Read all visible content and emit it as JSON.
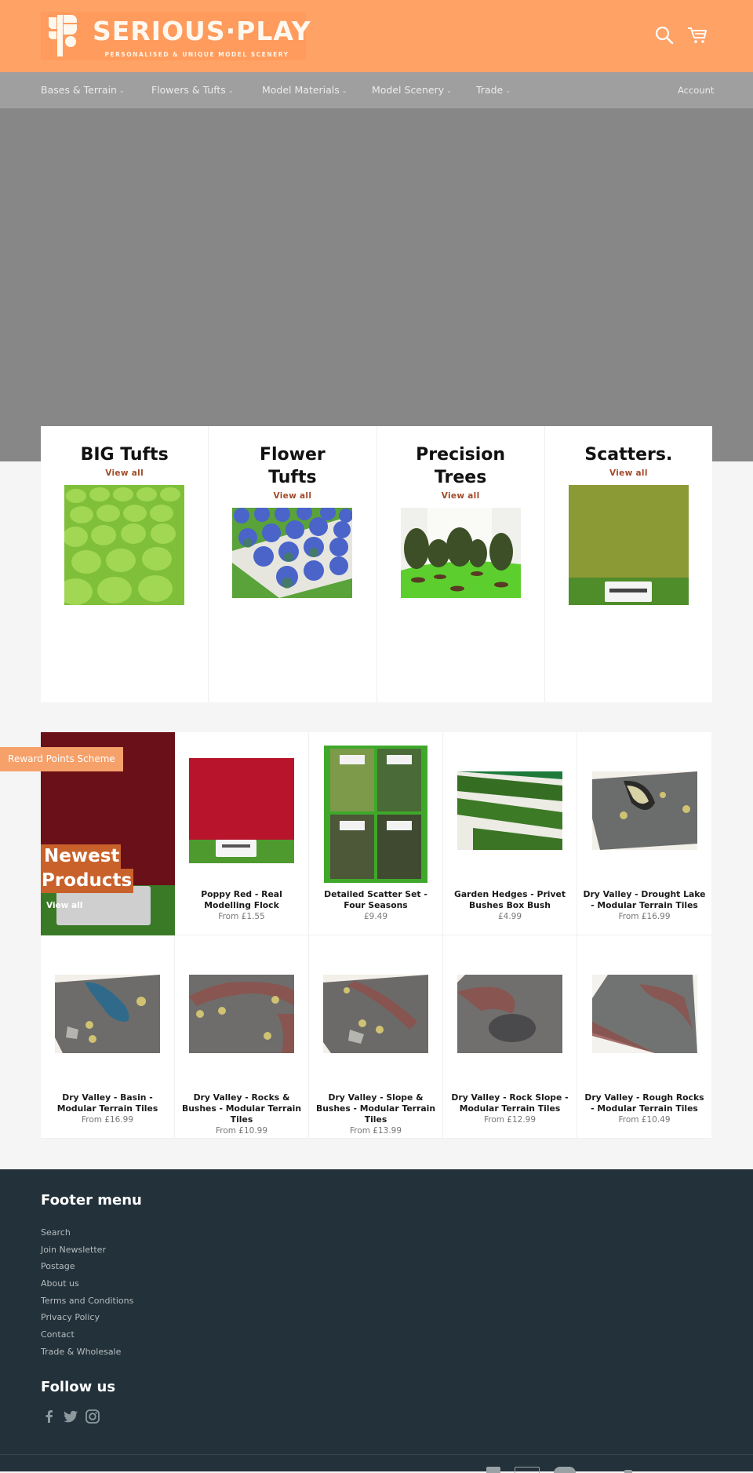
{
  "header": {
    "logo": {
      "wordmark": "SERIOUS·PLAY",
      "tagline": "PERSONALISED & UNIQUE MODEL SCENERY",
      "icon": "sp-monogram-icon"
    },
    "icons": [
      "search-icon",
      "cart-icon"
    ]
  },
  "nav": {
    "items": [
      {
        "label": "Bases & Terrain",
        "caret": "⌄"
      },
      {
        "label": "Flowers & Tufts",
        "caret": "⌄"
      },
      {
        "label": "Model Materials",
        "caret": "⌄"
      },
      {
        "label": "Model Scenery",
        "caret": "⌄"
      },
      {
        "label": "Trade",
        "caret": "⌄"
      }
    ],
    "account_label": "Account"
  },
  "collections": [
    {
      "title": "BIG Tufts",
      "link": "View all",
      "image": "green-grass-tufts"
    },
    {
      "title": "Flower Tufts",
      "link": "View all",
      "image": "blue-flower-tufts"
    },
    {
      "title": "Precision Trees",
      "link": "View all",
      "image": "model-trees"
    },
    {
      "title": "Scatters.",
      "link": "View all",
      "image": "olive-scatter"
    }
  ],
  "featured": {
    "title_line1": "Newest",
    "title_line2": "Products",
    "link": "View all"
  },
  "reward_label": "Reward Points Scheme",
  "products": [
    {
      "title": "Poppy Red - Real Modelling Flock",
      "price": "From £1.55"
    },
    {
      "title": "Detailed Scatter Set - Four Seasons",
      "price": "£9.49"
    },
    {
      "title": "Garden Hedges - Privet Bushes Box Bush",
      "price": "£4.99"
    },
    {
      "title": "Dry Valley - Drought Lake - Modular Terrain Tiles",
      "price": "From £16.99"
    },
    {
      "title": "Dry Valley - Basin - Modular Terrain Tiles",
      "price": "From £16.99"
    },
    {
      "title": "Dry Valley - Rocks & Bushes - Modular Terrain Tiles",
      "price": "From £10.99"
    },
    {
      "title": "Dry Valley - Slope & Bushes - Modular Terrain Tiles",
      "price": "From £13.99"
    },
    {
      "title": "Dry Valley - Rock Slope - Modular Terrain Tiles",
      "price": "From £12.99"
    },
    {
      "title": "Dry Valley - Rough Rocks - Modular Terrain Tiles",
      "price": "From £10.49"
    }
  ],
  "footer": {
    "menu_title": "Footer menu",
    "menu": [
      "Search",
      "Join Newsletter",
      "Postage",
      "About us",
      "Terms and Conditions",
      "Privacy Policy",
      "Contact",
      "Trade & Wholesale"
    ],
    "follow_title": "Follow us",
    "social": [
      "facebook-icon",
      "twitter-icon",
      "instagram-icon"
    ],
    "payment_icons": [
      "amex-icon",
      "apple-pay-icon",
      "mastercard-icon",
      "paypal-icon"
    ]
  },
  "colors": {
    "header_bg": "#ffa266",
    "nav_bg": "#a09fa0",
    "hero_bg": "#888787",
    "accent_link": "#a04b2b",
    "feature_label_bg": "#c9612a",
    "reward_bg": "#f6a06a",
    "footer_bg": "#22313a"
  }
}
